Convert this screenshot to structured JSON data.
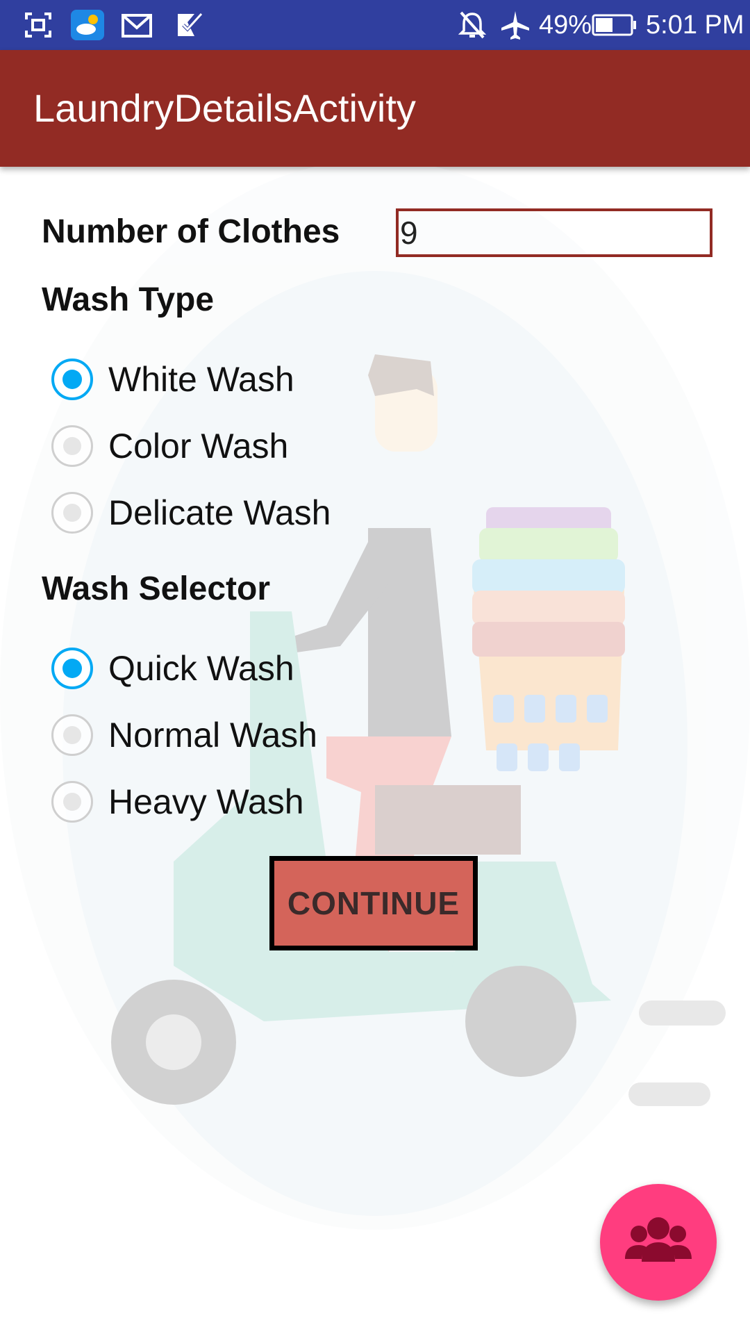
{
  "status_bar": {
    "icons": [
      "screenshot-icon",
      "weather-icon",
      "gmail-icon",
      "task-check-icon",
      "notifications-off-icon",
      "airplane-icon",
      "battery-icon"
    ],
    "battery": "49%",
    "time": "5:01 PM"
  },
  "app_bar": {
    "title": "LaundryDetailsActivity"
  },
  "form": {
    "clothes_label": "Number of Clothes",
    "clothes_value": "9",
    "wash_type_label": "Wash Type",
    "wash_type_options": [
      {
        "label": "White Wash",
        "selected": true
      },
      {
        "label": "Color Wash",
        "selected": false
      },
      {
        "label": "Delicate Wash",
        "selected": false
      }
    ],
    "wash_selector_label": "Wash Selector",
    "wash_selector_options": [
      {
        "label": "Quick Wash",
        "selected": true
      },
      {
        "label": "Normal Wash",
        "selected": false
      },
      {
        "label": "Heavy Wash",
        "selected": false
      }
    ],
    "continue_label": "CONTINUE"
  },
  "fab": {
    "icon": "group-icon"
  },
  "colors": {
    "status_bar": "#303F9F",
    "app_bar": "#922B24",
    "radio_accent": "#03A9F4",
    "button": "#D4645A",
    "fab": "#FF3D7F"
  }
}
